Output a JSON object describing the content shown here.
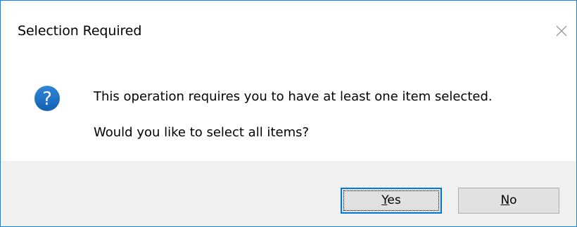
{
  "dialog": {
    "title": "Selection Required",
    "close_icon": "close-icon",
    "icon": "question-icon",
    "icon_color": "#1c6fc7",
    "message_line1": "This operation requires you to have at least one item selected.",
    "message_line2": "Would you like to select all items?",
    "buttons": {
      "yes_mnemonic": "Y",
      "yes_rest": "es",
      "no_mnemonic": "N",
      "no_rest": "o",
      "default": "Yes"
    },
    "accent_color": "#0078d7",
    "footer_color": "#f0f0f0"
  }
}
